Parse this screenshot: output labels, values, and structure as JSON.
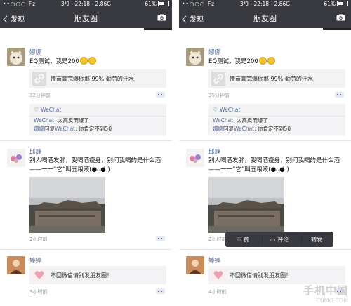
{
  "statusbar": {
    "carrier": "••○○○ Fz",
    "time": "3/9 - 22:18 - 2.86G",
    "battery": "61%"
  },
  "nav": {
    "back_label": "发现",
    "title": "朋友圈"
  },
  "posts": {
    "p1": {
      "user": "娜娜",
      "text": "EQ测试，我是200",
      "link_title": "情商高完爆你那 99% 勤劳的汗水",
      "comments": [
        {
          "name": "WeChat",
          "sep": ": ",
          "text": "太高反而爆了"
        },
        {
          "name": "娜娜",
          "reply": "回复",
          "name2": "WeChat",
          "sep": ": ",
          "text": "你肯定不到50"
        }
      ],
      "likes": "WeChat"
    },
    "p2": {
      "user": "邱静",
      "text": "别人喝酒发胖，我喝酒瘦身，别问我喝的是什么酒——一一“它”叫五粮液(●̀ᴗ●́ )",
      "time": "2小时前"
    },
    "p3": {
      "user": "婷婷",
      "link_title": "不回微信请别发朋友圈！"
    }
  },
  "screens": [
    {
      "p1_time": "32分钟前",
      "p3_time": "3小时前"
    },
    {
      "p1_time": "35分钟前",
      "p3_time": "4小时前"
    }
  ],
  "popup": {
    "like": "赞",
    "comment": "评论",
    "forward": "转发"
  },
  "watermark": {
    "line1": "手机中国",
    "line2": "CNMO.COM"
  },
  "colors": {
    "navbar": "#393a3f",
    "link_blue": "#576b95",
    "card_bg": "#f3f3f5"
  }
}
